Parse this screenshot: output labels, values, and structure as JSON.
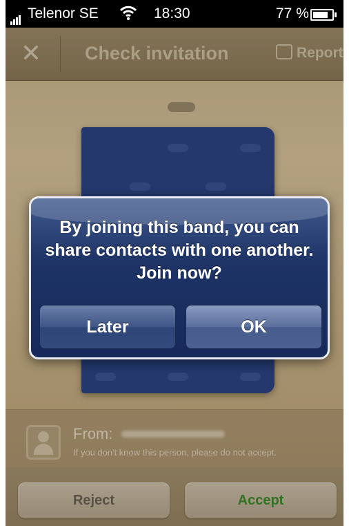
{
  "status_bar": {
    "carrier": "Telenor SE",
    "time": "18:30",
    "battery": "77 %"
  },
  "nav": {
    "title": "Check invitation",
    "report_label": "Report"
  },
  "alert": {
    "message": "By joining this band, you can share contacts with one another. Join now?",
    "later_label": "Later",
    "ok_label": "OK"
  },
  "from": {
    "label": "From:",
    "note": "If you don't know this person, please do not accept."
  },
  "actions": {
    "reject_label": "Reject",
    "accept_label": "Accept"
  },
  "colors": {
    "accept_text": "#3c8a2c",
    "alert_bg": "#1e3366",
    "band_cover": "#2c4585"
  }
}
